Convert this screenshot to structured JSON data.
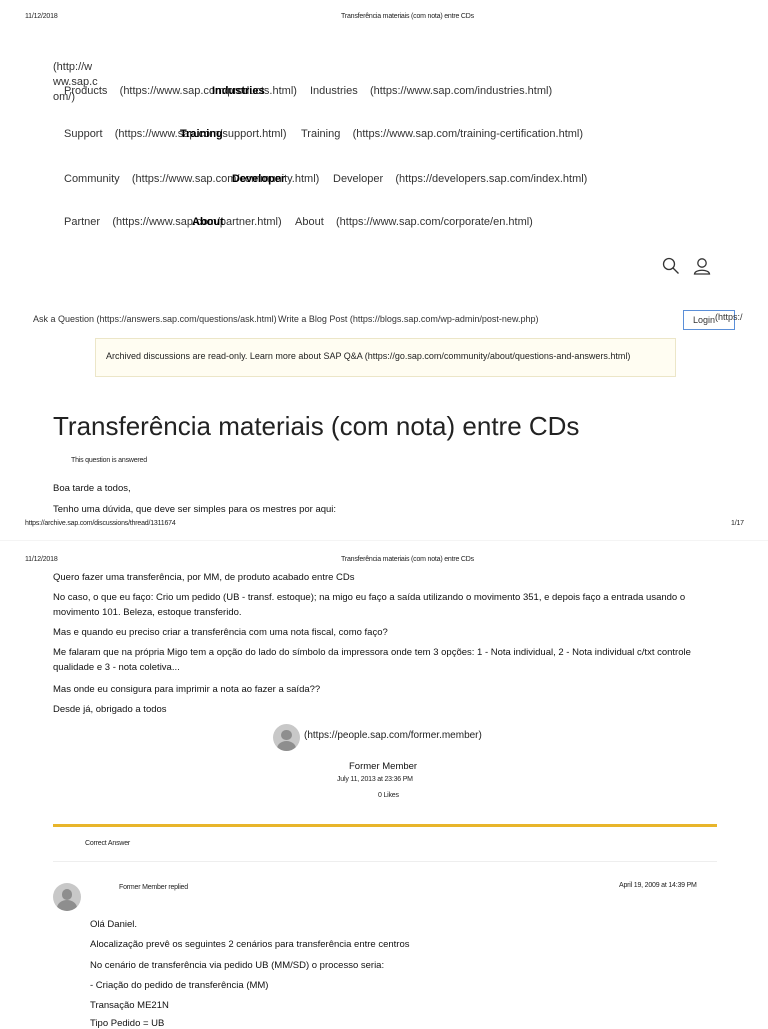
{
  "print_header": {
    "date": "11/12/2018",
    "title": "Transferência materiais (com nota) entre CDs"
  },
  "print_footer": {
    "url": "https://archive.sap.com/discussions/thread/1311674",
    "page": "1/17"
  },
  "logo_link": [
    "(http://w",
    "ww.sap.c",
    "om/)"
  ],
  "nav": {
    "rows": [
      {
        "label": "Products",
        "url": "(https://www.sap.com/products.html)",
        "overlay": "Industries",
        "label2": "Industries",
        "url2": "(https://www.sap.com/industries.html)"
      },
      {
        "label": "Support",
        "url": "(https://www.sap.com/support.html)",
        "overlay": "Training",
        "label2": "Training",
        "url2": "(https://www.sap.com/training-certification.html)"
      },
      {
        "label": "Community",
        "url": "(https://www.sap.com/community.html)",
        "overlay": "Developer",
        "label2": "Developer",
        "url2": "(https://developers.sap.com/index.html)"
      },
      {
        "label": "Partner",
        "url": "(https://www.sap.com/partner.html)",
        "overlay": "About",
        "label2": "About",
        "url2": "(https://www.sap.com/corporate/en.html)"
      }
    ]
  },
  "icons": {
    "search": "search-icon",
    "user": "user-icon"
  },
  "actions": {
    "ask": "Ask a Question (https://answers.sap.com/questions/ask.html)",
    "blog": "Write a Blog Post (https://blogs.sap.com/wp-admin/post-new.php)",
    "login": "Login",
    "login_url": "(https:/"
  },
  "banner": {
    "text": "Archived discussions are read-only. Learn more about SAP Q&A (https://go.sap.com/community/about/questions-and-answers.html)"
  },
  "question": {
    "title": "Transferência materiais (com nota) entre CDs",
    "answered": "This question is answered",
    "paragraphs_page1": [
      "Boa tarde a todos,",
      "Tenho uma dúvida, que deve ser simples para os mestres por aqui:"
    ],
    "paragraphs_page2": [
      "Quero fazer uma transferência, por MM, de produto acabado entre  CDs",
      "No caso, o que eu faço: Crio um pedido (UB - transf. estoque); na migo eu faço a saída utilizando o movimento 351, e depois faço a entrada usando o",
      "movimento 101. Beleza, estoque transferido.",
      "Mas e quando eu preciso criar a transferência com uma nota fiscal, como faço?",
      "Me falaram que na própria Migo tem a opção do lado do símbolo da impressora onde tem 3 opções: 1 - Nota individual, 2 - Nota individual c/txt controle",
      "qualidade e 3 - nota coletiva...",
      "Mas onde eu consigura para imprimir a nota ao fazer a saída??",
      "Desde já, obrigado a todos"
    ],
    "author_url": "(https://people.sap.com/former.member)",
    "author": "Former Member",
    "date": "July 11, 2013 at 23:36 PM",
    "likes": "0 Likes"
  },
  "answer": {
    "label": "Correct Answer",
    "author": "Former Member replied",
    "date": "April 19, 2009 at 14:39 PM",
    "lines": [
      "Olá Daniel.",
      "Alocalização prevê os seguintes 2 cenários para transferência entre centros",
      "No cenário de transferência via pedido UB (MM/SD) o processo seria:",
      "- Criação do pedido de transferência (MM)",
      "Transação ME21N",
      "Tipo Pedido = UB"
    ]
  }
}
